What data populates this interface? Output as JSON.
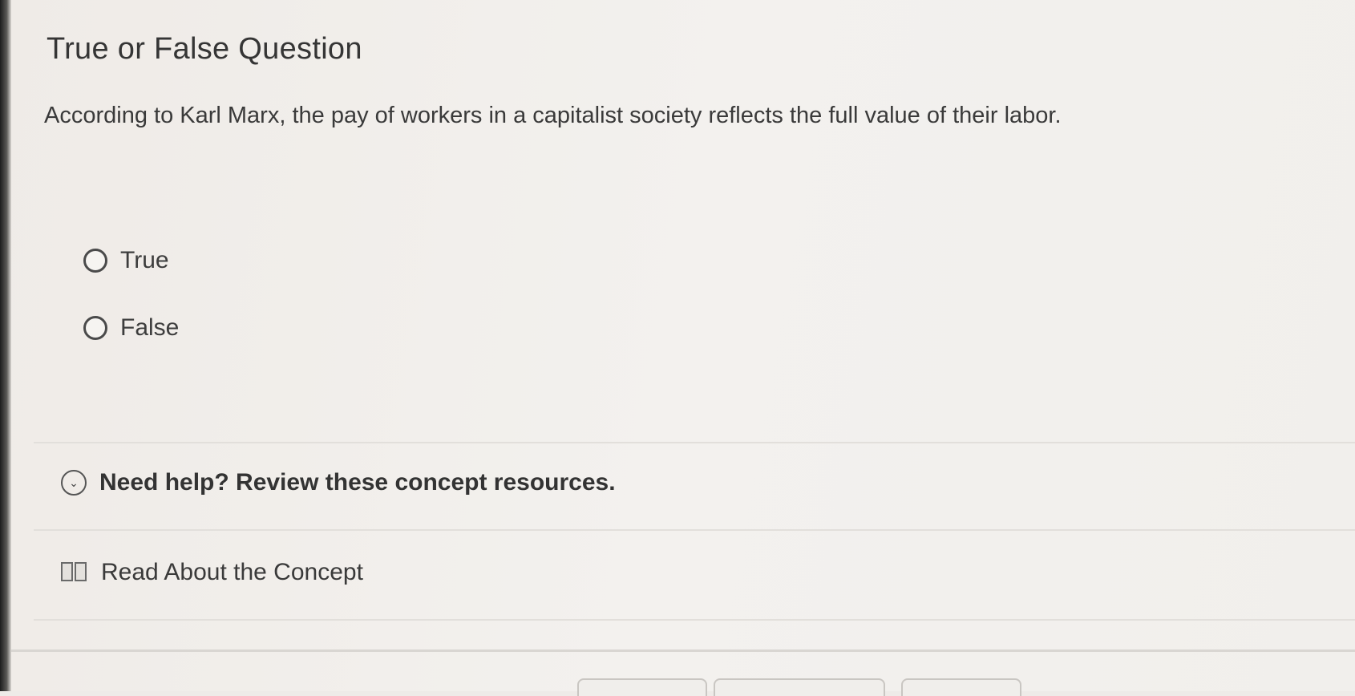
{
  "question": {
    "type_title": "True or False Question",
    "prompt": "According to Karl Marx, the pay of workers in a capitalist society reflects the full value of their labor.",
    "options": [
      {
        "label": "True",
        "selected": false
      },
      {
        "label": "False",
        "selected": false
      }
    ]
  },
  "help": {
    "icon": "chevron-down-circle-icon",
    "label": "Need help? Review these concept resources."
  },
  "resources": [
    {
      "icon": "book-icon",
      "label": "Read About the Concept"
    }
  ]
}
